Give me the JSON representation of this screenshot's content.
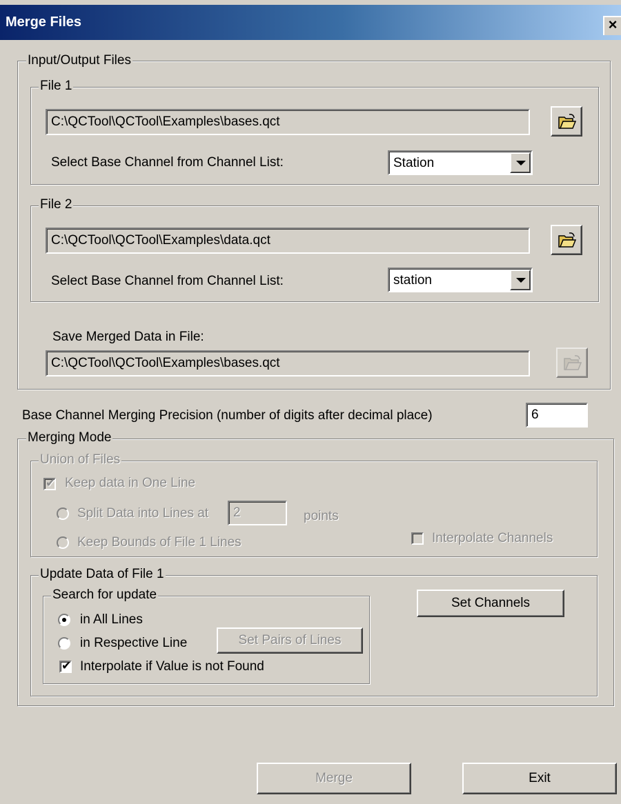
{
  "window": {
    "title": "Merge Files",
    "close_label": "×"
  },
  "io_group": {
    "legend": "Input/Output Files",
    "file1": {
      "legend": "File 1",
      "path": "C:\\QCTool\\QCTool\\Examples\\bases.qct",
      "channel_label": "Select Base Channel from Channel List:",
      "channel_value": "Station"
    },
    "file2": {
      "legend": "File 2",
      "path": "C:\\QCTool\\QCTool\\Examples\\data.qct",
      "channel_label": "Select Base Channel from Channel List:",
      "channel_value": "station"
    },
    "save": {
      "label": "Save Merged Data in File:",
      "path": "C:\\QCTool\\QCTool\\Examples\\bases.qct"
    }
  },
  "precision": {
    "label": "Base Channel Merging Precision (number of digits after decimal place)",
    "value": "6"
  },
  "merging_mode": {
    "legend": "Merging Mode",
    "union": {
      "legend": "Union of Files",
      "keep_one_line": "Keep data in One Line",
      "split_label": "Split Data into Lines at",
      "split_value": "2",
      "split_suffix": "points",
      "keep_bounds": "Keep Bounds of File 1 Lines",
      "interpolate_channels": "Interpolate Channels"
    },
    "update": {
      "legend": "Update Data of File 1",
      "search": {
        "legend": "Search for update",
        "all_lines": "in All Lines",
        "respective_line": "in Respective Line",
        "interpolate": "Interpolate if Value is not Found"
      },
      "set_pairs_label": "Set Pairs of Lines",
      "set_channels_label": "Set Channels"
    }
  },
  "footer": {
    "merge_label": "Merge",
    "exit_label": "Exit"
  },
  "icons": {
    "folder": "open-folder-icon",
    "checked_mark": "✔"
  }
}
